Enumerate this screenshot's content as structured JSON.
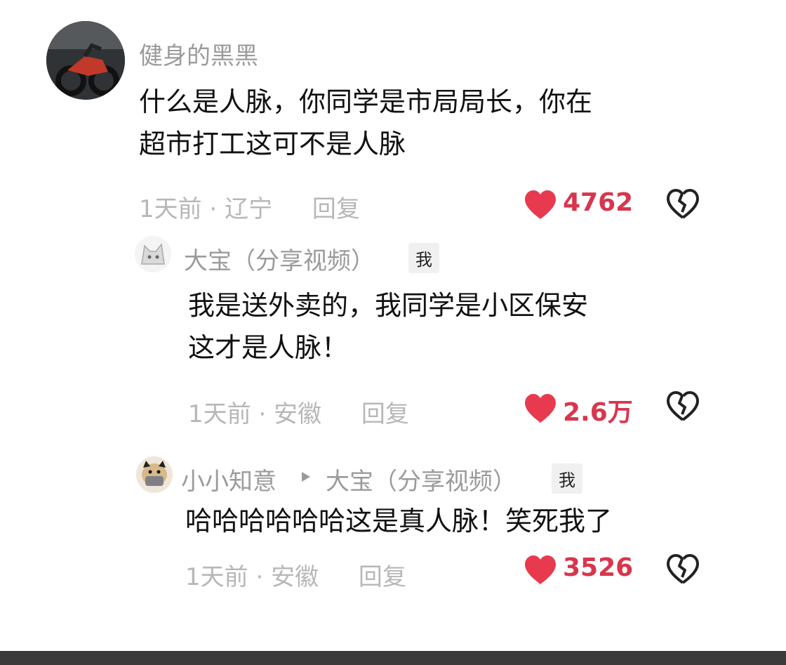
{
  "comments": [
    {
      "username": "健身的黑黑",
      "lines": [
        "什么是人脉，你同学是市局局长，你在",
        "超市打工这可不是人脉"
      ],
      "time": "1天前",
      "location": "辽宁",
      "reply_label": "回复",
      "likes": "4762"
    },
    {
      "username": "大宝（分享视频）",
      "tag": "我",
      "lines": [
        "我是送外卖的，我同学是小区保安",
        "这才是人脉！"
      ],
      "time": "1天前",
      "location": "安徽",
      "reply_label": "回复",
      "likes": "2.6万"
    },
    {
      "username": "小小知意",
      "reply_to": "大宝（分享视频）",
      "tag": "我",
      "lines": [
        "哈哈哈哈哈哈这是真人脉！笑死我了"
      ],
      "time": "1天前",
      "location": "安徽",
      "reply_label": "回复",
      "likes": "3526"
    }
  ],
  "colors": {
    "like_red": "#e83a4f",
    "meta_gray": "#b7b7b7",
    "name_gray": "#9b9b9b"
  },
  "icons": {
    "like": "heart-icon",
    "dislike": "broken-heart-icon",
    "reply_arrow": "triangle-right-icon"
  }
}
